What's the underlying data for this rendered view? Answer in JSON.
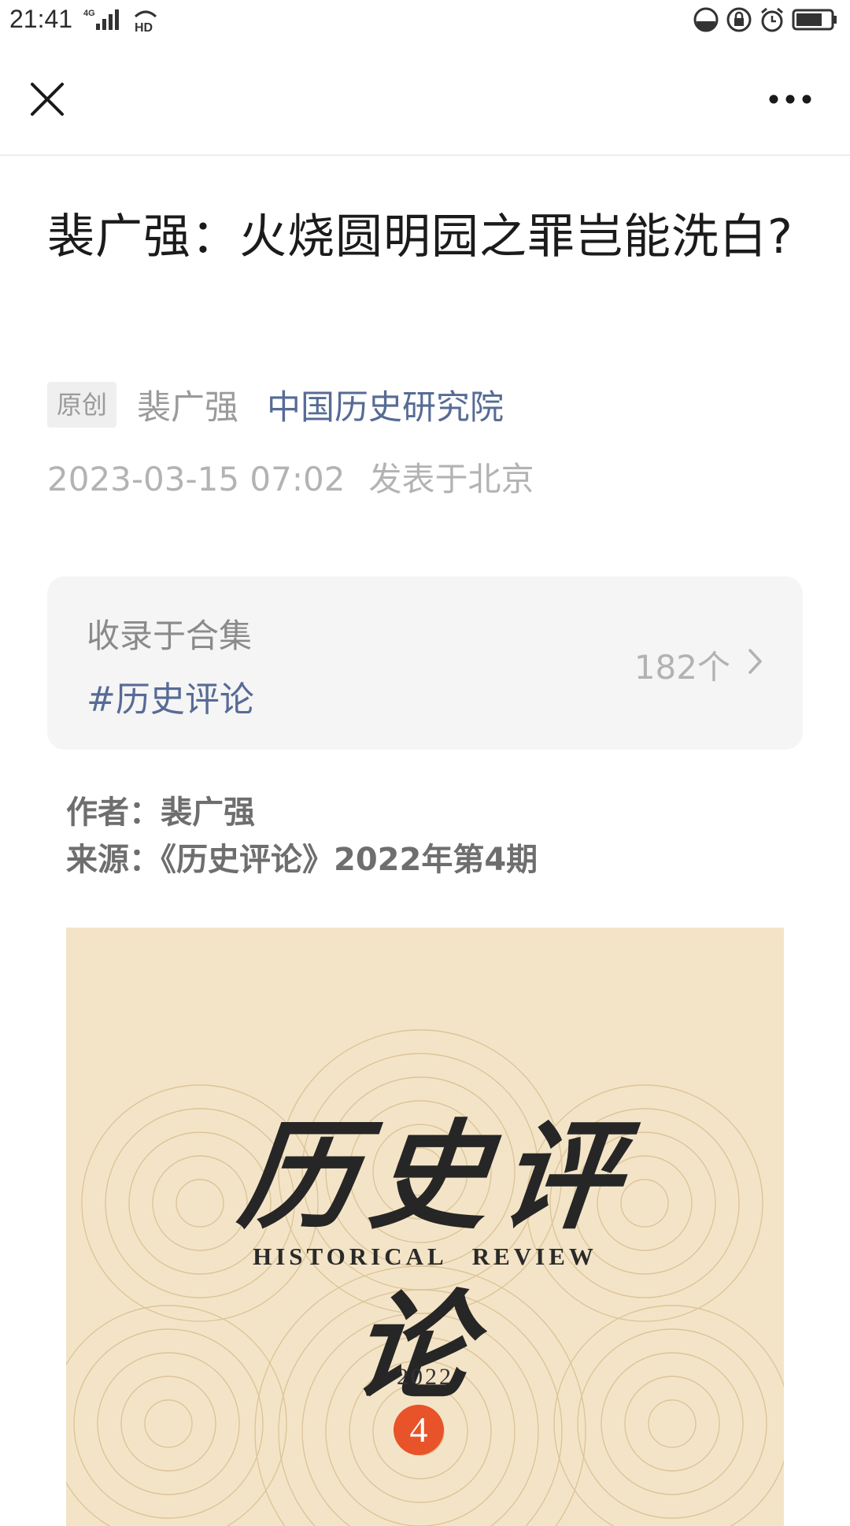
{
  "status_bar": {
    "time": "21:41",
    "network": "4G",
    "hd": "HD",
    "icons": [
      "signal-icon",
      "hd-icon",
      "data-saver-icon",
      "lock-rotation-icon",
      "alarm-icon",
      "battery-icon"
    ]
  },
  "nav": {
    "close_icon": "close-icon",
    "more_icon": "more-icon"
  },
  "article": {
    "title": "裴广强：火烧圆明园之罪岂能洗白?",
    "badge": "原创",
    "author": "裴广强",
    "account": "中国历史研究院",
    "date": "2023-03-15 07:02",
    "location": "发表于北京"
  },
  "collection": {
    "label": "收录于合集",
    "tag": "#历史评论",
    "count": "182个"
  },
  "info": {
    "author_line": "作者：裴广强",
    "source_line": "来源：《历史评论》2022年第4期"
  },
  "cover": {
    "title_cn": "历史评论",
    "title_en": "HISTORICAL REVIEW",
    "year": "2022",
    "issue": "4"
  },
  "colors": {
    "link": "#576b95",
    "cover_bg": "#f4e4c7",
    "issue_badge": "#e8532a"
  }
}
